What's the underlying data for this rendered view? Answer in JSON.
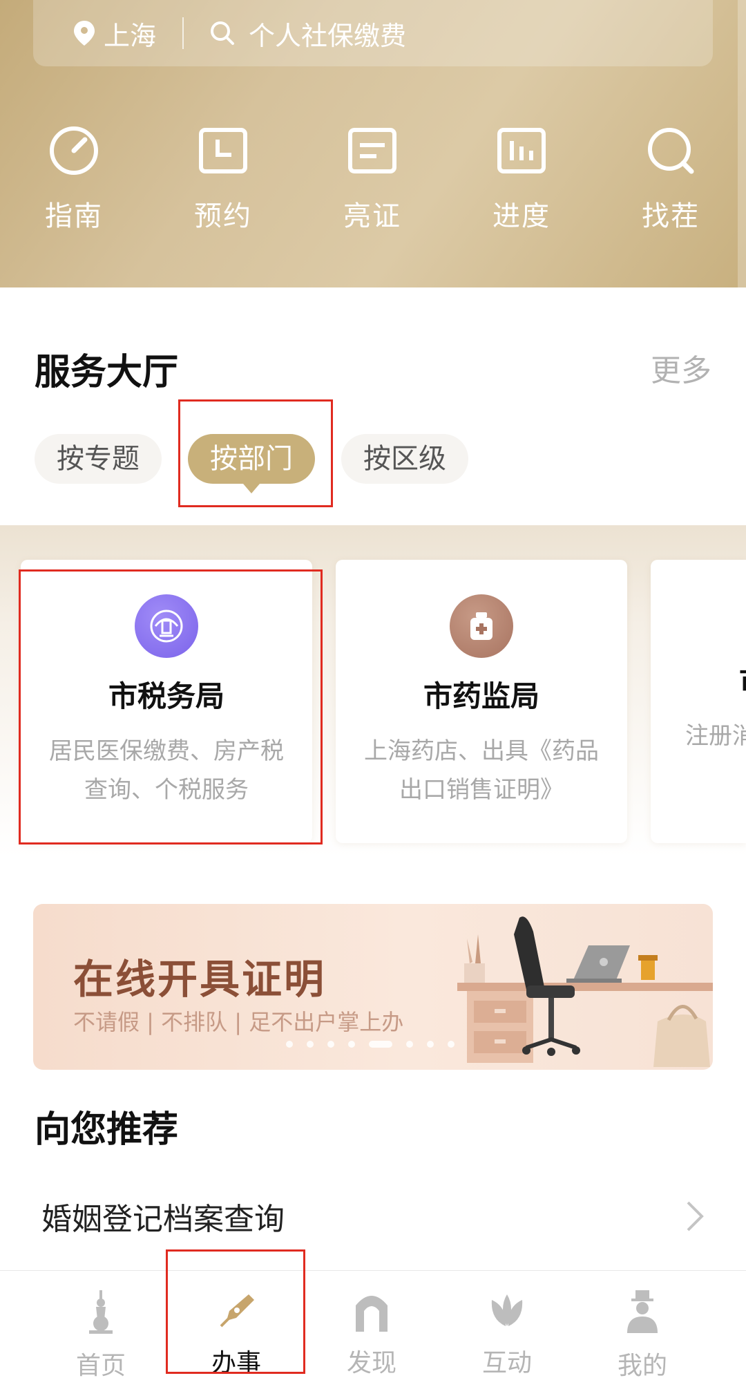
{
  "search": {
    "location": "上海",
    "placeholder": "个人社保缴费"
  },
  "quick_actions": [
    {
      "label": "指南",
      "icon": "gauge-icon"
    },
    {
      "label": "预约",
      "icon": "calendar-icon"
    },
    {
      "label": "亮证",
      "icon": "id-card-icon"
    },
    {
      "label": "进度",
      "icon": "bar-chart-icon"
    },
    {
      "label": "找茬",
      "icon": "search-icon"
    }
  ],
  "service_hall": {
    "title": "服务大厅",
    "more": "更多",
    "tabs": [
      {
        "label": "按专题",
        "active": false
      },
      {
        "label": "按部门",
        "active": true
      },
      {
        "label": "按区级",
        "active": false
      }
    ],
    "departments": [
      {
        "name": "市税务局",
        "desc": "居民医保缴费、房产税查询、个税服务",
        "icon": "tax-bureau-icon",
        "color": "#8f78f2"
      },
      {
        "name": "市药监局",
        "desc": "上海药店、出具《药品出口销售证明》",
        "icon": "medicine-bottle-icon",
        "color": "#b58470"
      },
      {
        "name": "市",
        "desc": "注册消",
        "icon": "department-icon",
        "color": "#c8b07a"
      }
    ]
  },
  "banner": {
    "title": "在线开具证明",
    "subtitle": "不请假 | 不排队 | 足不出户掌上办"
  },
  "recommend": {
    "title": "向您推荐",
    "items": [
      {
        "label": "婚姻登记档案查询"
      }
    ]
  },
  "bottom_nav": [
    {
      "label": "首页",
      "icon": "pearl-tower-icon",
      "active": false
    },
    {
      "label": "办事",
      "icon": "pen-nib-icon",
      "active": true
    },
    {
      "label": "发现",
      "icon": "arch-icon",
      "active": false
    },
    {
      "label": "互动",
      "icon": "magnolia-icon",
      "active": false
    },
    {
      "label": "我的",
      "icon": "person-icon",
      "active": false
    }
  ],
  "colors": {
    "gold": "#c8b07a",
    "highlight": "#e02b20",
    "banner_text": "#8b4f37"
  }
}
